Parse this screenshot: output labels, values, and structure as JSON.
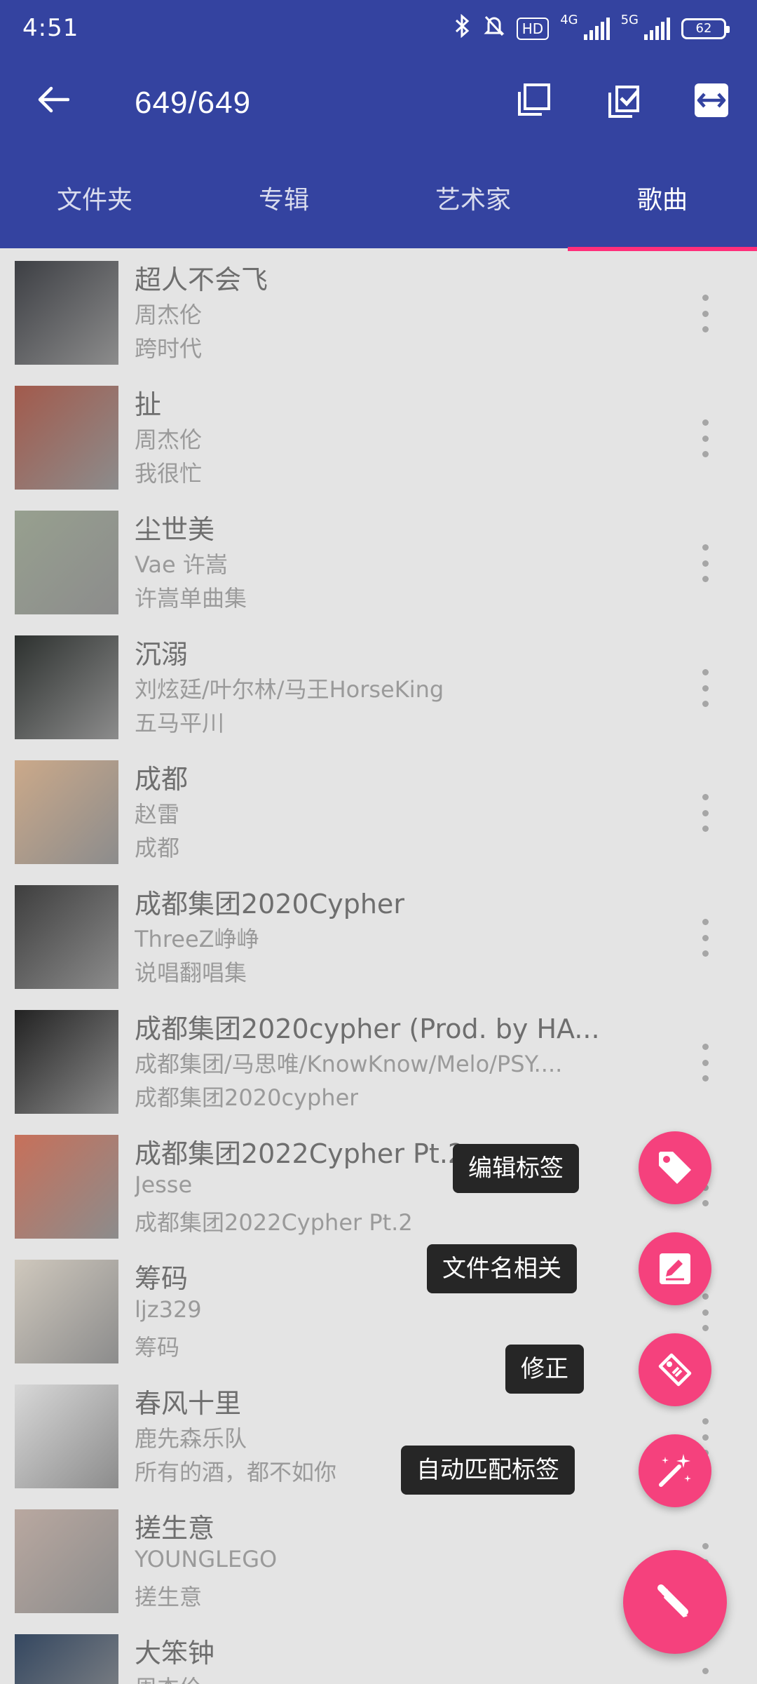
{
  "status": {
    "time": "4:51",
    "net1": "4G",
    "net2": "5G",
    "hd": "HD",
    "battery": "62"
  },
  "appbar": {
    "title": "649/649"
  },
  "tabs": [
    {
      "label": "文件夹",
      "active": false
    },
    {
      "label": "专辑",
      "active": false
    },
    {
      "label": "艺术家",
      "active": false
    },
    {
      "label": "歌曲",
      "active": true
    }
  ],
  "songs": [
    {
      "title": "超人不会飞",
      "artist": "周杰伦",
      "album": "跨时代",
      "cover_color": "#3d3f44"
    },
    {
      "title": "扯",
      "artist": "周杰伦",
      "album": "我很忙",
      "cover_color": "#a25a4c"
    },
    {
      "title": "尘世美",
      "artist": "Vae 许嵩",
      "album": "许嵩单曲集",
      "cover_color": "#97a08f"
    },
    {
      "title": "沉溺",
      "artist": "刘炫廷/叶尔林/马王HorseKing",
      "album": "五马平川",
      "cover_color": "#2d312f"
    },
    {
      "title": "成都",
      "artist": "赵雷",
      "album": "成都",
      "cover_color": "#cba98a"
    },
    {
      "title": "成都集团2020Cypher",
      "artist": "ThreeZ峥峥",
      "album": "说唱翻唱集",
      "cover_color": "#3e3e3e"
    },
    {
      "title": "成都集团2020cypher (Prod. by HA...",
      "artist": "成都集团/马思唯/KnowKnow/Melo/PSY....",
      "album": "成都集团2020cypher",
      "cover_color": "#222222"
    },
    {
      "title": "成都集团2022Cypher Pt.2",
      "artist": "Jesse",
      "album": "成都集团2022Cypher Pt.2",
      "cover_color": "#c7705a"
    },
    {
      "title": "筹码",
      "artist": "ljz329",
      "album": "筹码",
      "cover_color": "#cfc8bd"
    },
    {
      "title": "春风十里",
      "artist": "鹿先森乐队",
      "album": "所有的酒，都不如你",
      "cover_color": "#d8d8d8"
    },
    {
      "title": "搓生意",
      "artist": "YOUNGLEGO",
      "album": "搓生意",
      "cover_color": "#b9a8a0"
    },
    {
      "title": "大笨钟",
      "artist": "周杰伦",
      "album": "",
      "cover_color": "#344760"
    }
  ],
  "fab_menu": [
    {
      "label": "编辑标签",
      "icon": "tag-icon"
    },
    {
      "label": "文件名相关",
      "icon": "rename-icon"
    },
    {
      "label": "修正",
      "icon": "fix-tag-icon"
    },
    {
      "label": "自动匹配标签",
      "icon": "magic-wand-icon"
    }
  ],
  "fab_main_icon": "pencil-icon",
  "colors": {
    "primary": "#3443a0",
    "accent": "#f5417d",
    "indicator": "#ff2e7a"
  }
}
